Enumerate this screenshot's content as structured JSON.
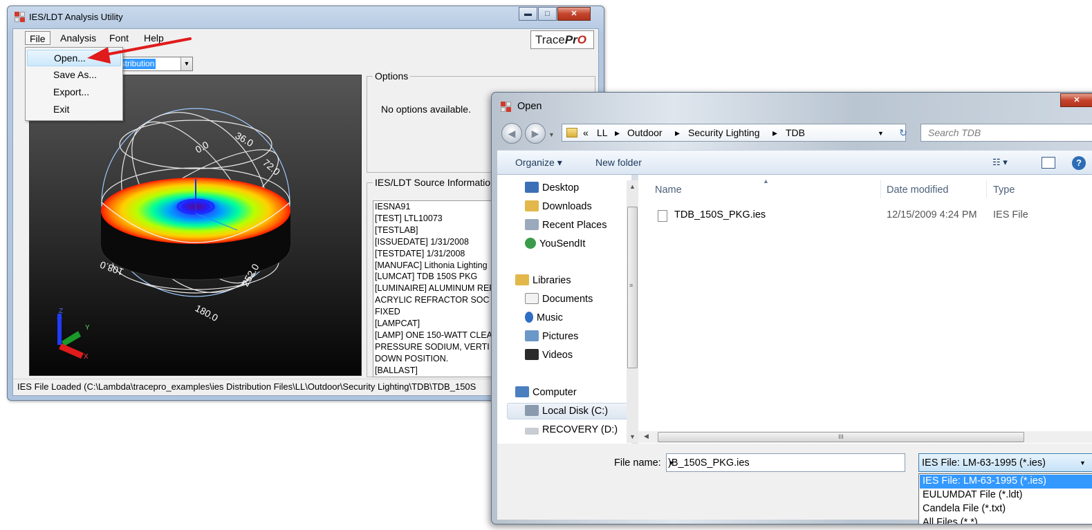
{
  "main_window": {
    "title": "IES/LDT Analysis Utility",
    "min_btn": "▬",
    "max_btn": "□",
    "close_btn": "✕",
    "menu": [
      "File",
      "Analysis",
      "Font",
      "Help"
    ],
    "logo": {
      "text": "Trace",
      "text_bold": "Pr",
      "text_o": "O"
    },
    "view_combo": {
      "value": "r Distribution"
    },
    "file_menu": [
      "Open...",
      "Save As...",
      "Export...",
      "Exit"
    ],
    "plot_labels": [
      "0.0",
      "36.0",
      "72.0",
      "108.0",
      "180.0",
      "252.0"
    ],
    "axis_labels": [
      "Z",
      "Y",
      "X"
    ],
    "options": {
      "title": "Options",
      "text": "No options available."
    },
    "source_info": {
      "title": "IES/LDT Source Information",
      "lines": [
        "IESNA91",
        "[TEST] LTL10073",
        "[TESTLAB]",
        "[ISSUEDATE] 1/31/2008",
        "[TESTDATE] 1/31/2008",
        "[MANUFAC] Lithonia Lighting",
        "[LUMCAT] TDB 150S PKG",
        "[LUMINAIRE] ALUMINUM REF",
        "ACRYLIC REFRACTOR SOC",
        "FIXED",
        "[LAMPCAT]",
        "[LAMP] ONE 150-WATT CLEA",
        "PRESSURE SODIUM, VERTI",
        "DOWN POSITION.",
        "[BALLAST]"
      ]
    },
    "status": "IES File Loaded (C:\\Lambda\\tracepro_examples\\ies Distribution Files\\LL\\Outdoor\\Security Lighting\\TDB\\TDB_150S"
  },
  "open_dialog": {
    "title": "Open",
    "breadcrumb": [
      "«",
      "LL",
      "▸",
      "Outdoor",
      "▸",
      "Security Lighting",
      "▸",
      "TDB"
    ],
    "search_placeholder": "Search TDB",
    "organize": "Organize ▾",
    "new_folder": "New folder",
    "nav": {
      "favorites": [
        "Desktop",
        "Downloads",
        "Recent Places",
        "YouSendIt"
      ],
      "libraries_label": "Libraries",
      "libraries": [
        "Documents",
        "Music",
        "Pictures",
        "Videos"
      ],
      "computer_label": "Computer",
      "drives": [
        "Local Disk (C:)",
        "RECOVERY (D:)"
      ]
    },
    "columns": {
      "name": "Name",
      "date": "Date modified",
      "type": "Type"
    },
    "files": [
      {
        "name": "TDB_150S_PKG.ies",
        "date": "12/15/2009 4:24 PM",
        "type": "IES File"
      }
    ],
    "file_name_label": "File name:",
    "file_name_value": ")B_150S_PKG.ies",
    "file_type": {
      "selected": "IES File: LM-63-1995 (*.ies)",
      "options": [
        "IES File: LM-63-1995 (*.ies)",
        "EULUMDAT File (*.ldt)",
        "Candela File (*.txt)",
        "All Files (*.*)"
      ]
    },
    "scroll_grip": "III"
  },
  "colors": {
    "arrow": "#e01b1b",
    "selection": "#3399ff"
  }
}
